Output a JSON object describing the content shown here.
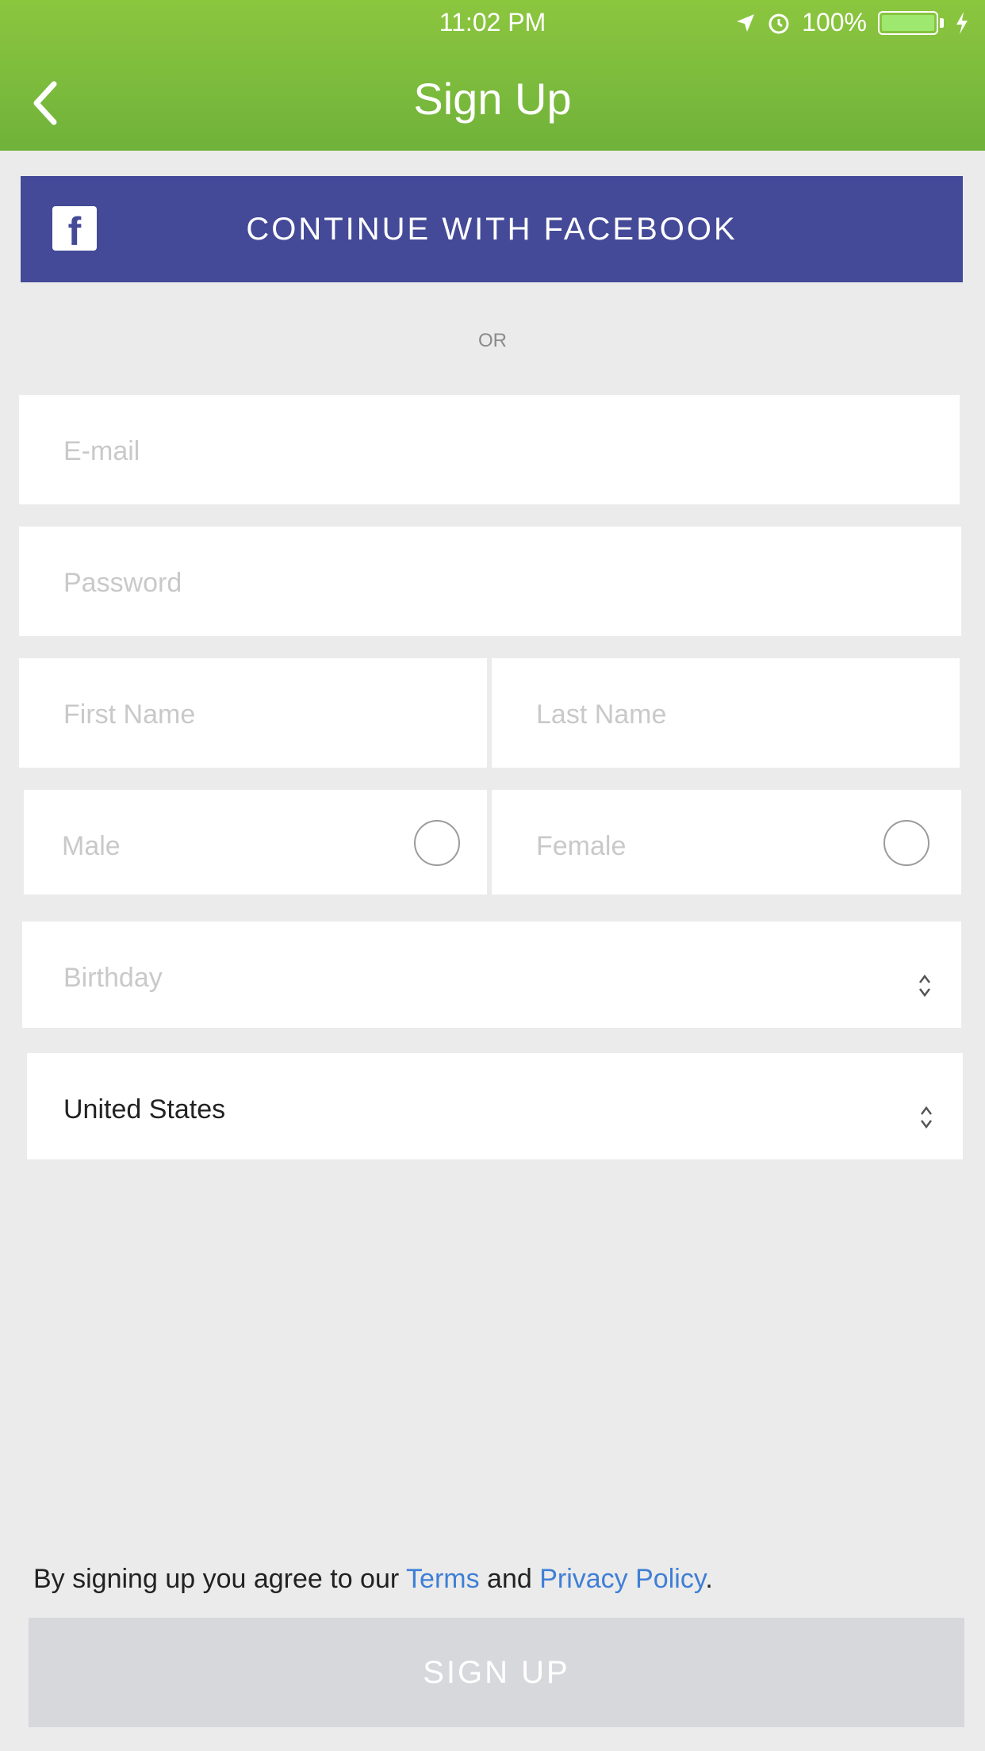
{
  "status_bar": {
    "time": "11:02 PM",
    "battery": "100%"
  },
  "header": {
    "title": "Sign Up"
  },
  "facebook": {
    "label": "CONTINUE WITH FACEBOOK"
  },
  "divider": {
    "text": "OR"
  },
  "form": {
    "email_placeholder": "E-mail",
    "password_placeholder": "Password",
    "first_name_placeholder": "First Name",
    "last_name_placeholder": "Last Name",
    "gender_male": "Male",
    "gender_female": "Female",
    "birthday_placeholder": "Birthday",
    "country_value": "United States"
  },
  "footer": {
    "terms_prefix": "By signing up you agree to our ",
    "terms_link": "Terms",
    "and": " and ",
    "privacy_link": "Privacy Policy",
    "period": ".",
    "signup_label": "SIGN UP"
  },
  "colors": {
    "header": "#7dbb3c",
    "facebook": "#444a97",
    "link": "#3f7fd6",
    "signup_disabled": "#d7d8dc"
  }
}
